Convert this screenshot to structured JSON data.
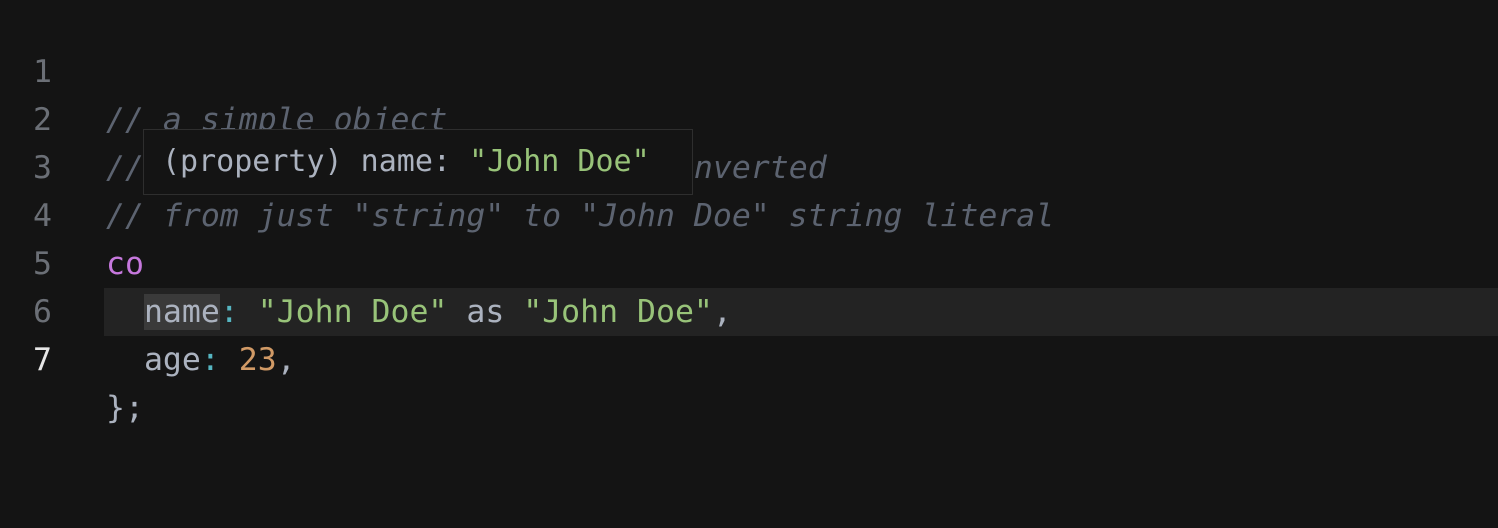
{
  "editor": {
    "current_line": 7,
    "lines": [
      {
        "number": "1",
        "comment": "// a simple object"
      },
      {
        "number": "2",
        "comment": "// with \"name\" property type converted"
      },
      {
        "number": "3",
        "comment": "// from just \"string\" to \"John Doe\" string literal"
      },
      {
        "number": "4",
        "keyword_partial": "co"
      },
      {
        "number": "5",
        "indent": "  ",
        "key": "name",
        "colon": ":",
        "value": "\"John Doe\"",
        "as": " as ",
        "cast": "\"John Doe\"",
        "end": ","
      },
      {
        "number": "6",
        "indent": "  ",
        "key": "age",
        "colon": ":",
        "value": "23",
        "end": ","
      },
      {
        "number": "7",
        "text": "};"
      }
    ]
  },
  "tooltip": {
    "kind": "(property)",
    "name": " name: ",
    "type": "\"John Doe\""
  },
  "colors": {
    "background": "#141414",
    "comment": "#5c6370",
    "keyword": "#c678dd",
    "string": "#98c379",
    "number": "#d19a66",
    "punctuation": "#56b6c2"
  }
}
